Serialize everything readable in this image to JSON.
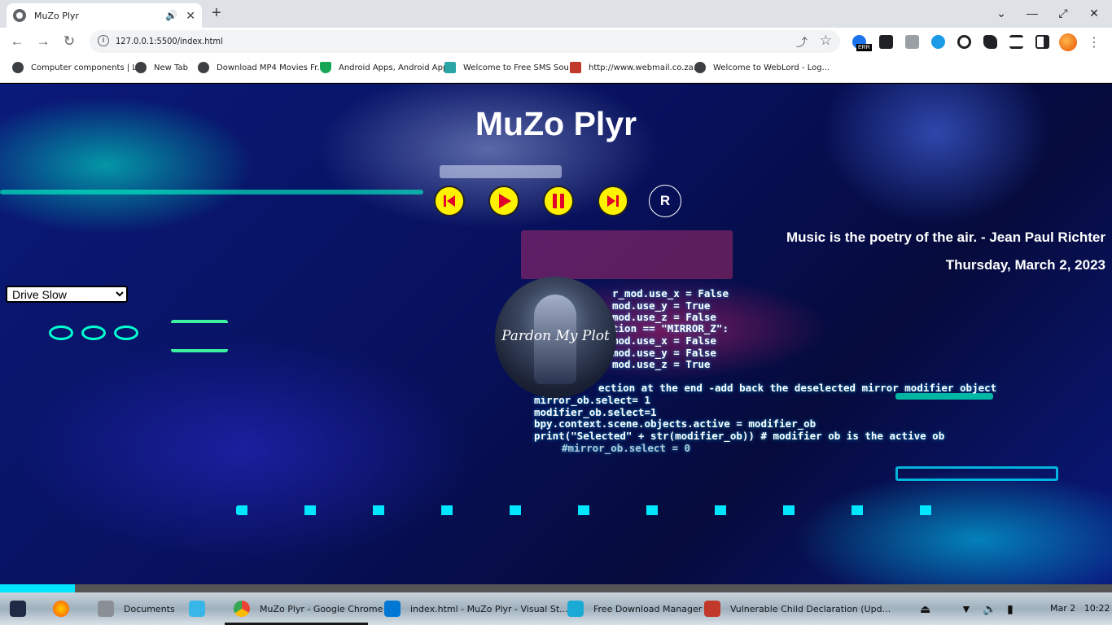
{
  "browser": {
    "tab_title": "MuZo Plyr",
    "url": "127.0.0.1:5500/index.html",
    "ext_badge": "ERR",
    "bookmarks": [
      "Computer components | L...",
      "New Tab",
      "Download MP4 Movies Fr...",
      "Android Apps, Android App...",
      "Welcome to Free SMS Sou...",
      "http://www.webmail.co.za...",
      "Welcome to WebLord - Log..."
    ]
  },
  "player": {
    "title": "MuZo Plyr",
    "repeat_label": "R",
    "quote": "Music is the poetry of the air. - Jean Paul Richter",
    "date": "Thursday, March 2, 2023",
    "selected_song": "Drive Slow",
    "album_signature": "Pardon My Plot",
    "progress": 0.067
  },
  "code_lines": [
    "r_mod.use_x = False",
    "mod.use_y = True",
    "mod.use_z = False",
    "tion == \"MIRROR_Z\":",
    "mod.use_x = False",
    "mod.use_y = False",
    "mod.use_z = True",
    "ection at the end -add back the deselected mirror modifier object",
    "mirror_ob.select= 1",
    "modifier_ob.select=1",
    "bpy.context.scene.objects.active = modifier_ob",
    "print(\"Selected\" + str(modifier_ob)) # modifier ob is the active ob",
    "#mirror_ob.select = 0"
  ],
  "taskbar": {
    "items": [
      "Documents",
      "MuZo Plyr - Google Chrome",
      "index.html - MuZo Plyr - Visual St...",
      "Free Download Manager",
      "Vulnerable Child Declaration (Upd..."
    ],
    "date": "Mar 2",
    "time": "10:22"
  },
  "colors": {
    "control_yellow": "#fff200",
    "control_red": "#e0002a",
    "progress": "#00e5ff"
  }
}
